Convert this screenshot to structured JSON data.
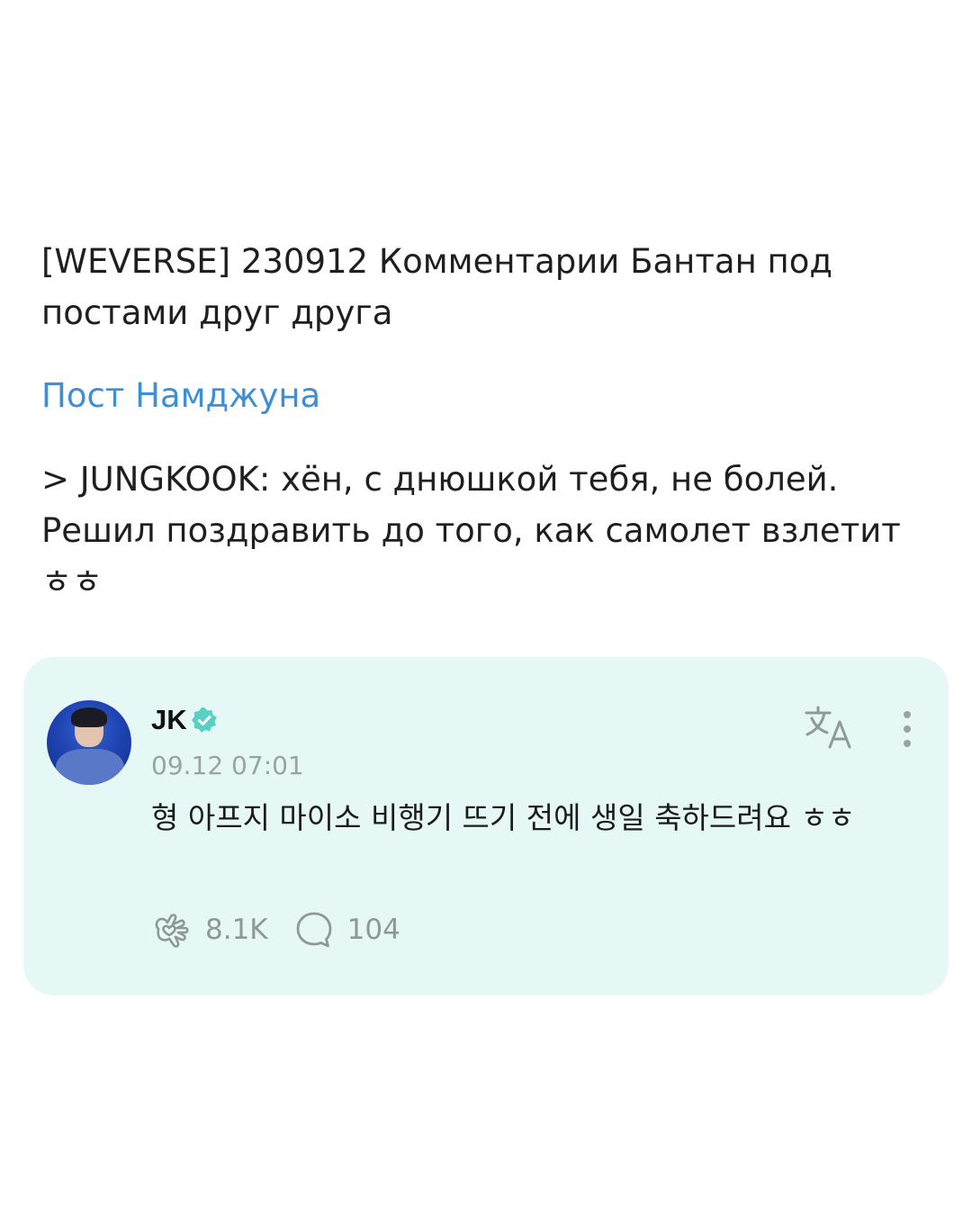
{
  "post": {
    "title": "[WEVERSE] 230912 Комментарии Бантан под постами друг друга",
    "link_label": "Пост Намджуна",
    "quote_line_1": "> JUNGKOOK: хён, с днюшкой тебя, не болей.",
    "quote_line_2": "Решил поздравить до того, как самолет взлетит",
    "quote_line_3": "ㅎㅎ"
  },
  "comment_card": {
    "author": "JK",
    "verified_icon": "verified-badge-icon",
    "timestamp": "09.12 07:01",
    "text": "형 아프지 마이소 비행기 뜨기 전에 생일 축하드려요 ㅎㅎ",
    "likes_count": "8.1K",
    "replies_count": "104",
    "accent_color": "#5ad0c4",
    "background_color": "#e6f8f5"
  }
}
